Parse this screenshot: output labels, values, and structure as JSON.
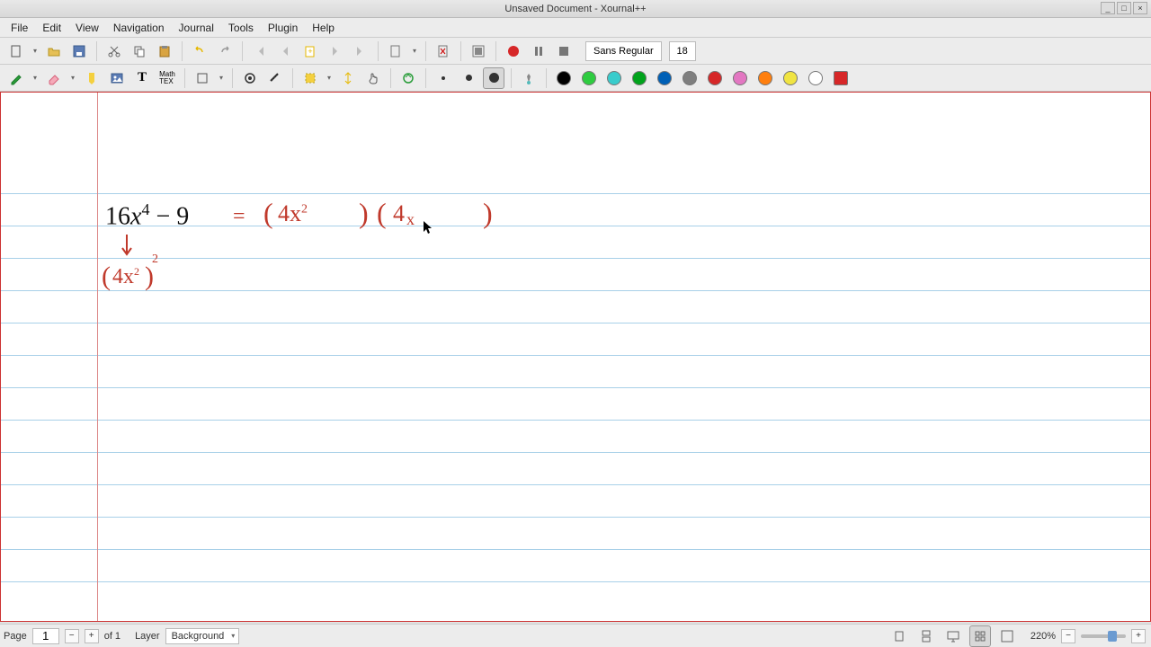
{
  "window": {
    "title": "Unsaved Document - Xournal++"
  },
  "menu": {
    "file": "File",
    "edit": "Edit",
    "view": "View",
    "navigation": "Navigation",
    "journal": "Journal",
    "tools": "Tools",
    "plugin": "Plugin",
    "help": "Help"
  },
  "toolbar": {
    "font_name": "Sans Regular",
    "font_size": "18"
  },
  "colors": {
    "black": "#000000",
    "green": "#2ecc40",
    "cyan": "#39cccc",
    "green2": "#01a31c",
    "blue": "#0060b6",
    "gray": "#7f7f7f",
    "red": "#d62728",
    "magenta": "#e377c2",
    "orange": "#ff7f0e",
    "yellow": "#f0e442",
    "white": "#ffffff",
    "redsq": "#d62728"
  },
  "math": {
    "expr_16": "16",
    "expr_x": "x",
    "expr_sup4": "4",
    "expr_minus": " − ",
    "expr_9": "9",
    "eq": "=",
    "paren1_open": "(",
    "term1": "4x",
    "term1_sup": "2",
    "paren1_close": ")",
    "paren2_open": "(",
    "term2": " 4",
    "term2_tail": "x",
    "paren2_close": ")",
    "line2_open": "(",
    "line2_term": "4x",
    "line2_sup": "2",
    "line2_close": ")",
    "line2_outer_sup": "2"
  },
  "status": {
    "page_label": "Page",
    "page_current": "1",
    "page_of": "of 1",
    "layer_label": "Layer",
    "layer_name": "Background",
    "zoom": "220%"
  }
}
